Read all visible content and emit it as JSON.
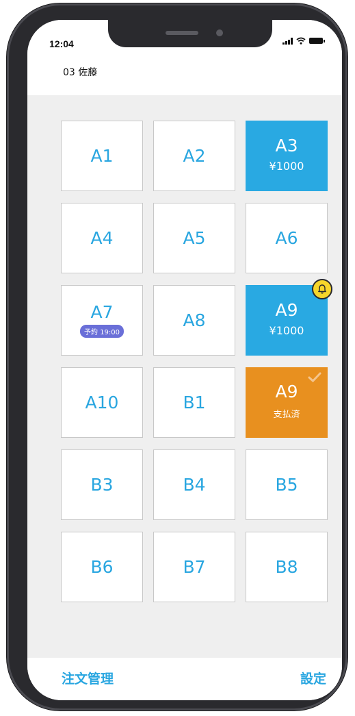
{
  "status_bar": {
    "time": "12:04"
  },
  "header": {
    "user": "03 佐藤"
  },
  "tables": [
    {
      "label": "A1",
      "state": "empty"
    },
    {
      "label": "A2",
      "state": "empty"
    },
    {
      "label": "A3",
      "state": "occupied",
      "amount": "¥1000"
    },
    {
      "label": "A4",
      "state": "empty"
    },
    {
      "label": "A5",
      "state": "empty"
    },
    {
      "label": "A6",
      "state": "empty"
    },
    {
      "label": "A7",
      "state": "reserved",
      "reservation": "予約 19:00"
    },
    {
      "label": "A8",
      "state": "empty"
    },
    {
      "label": "A9",
      "state": "occupied",
      "amount": "¥1000",
      "bell": true
    },
    {
      "label": "A10",
      "state": "empty"
    },
    {
      "label": "B1",
      "state": "empty"
    },
    {
      "label": "A9",
      "state": "paid",
      "paid_label": "支払済"
    },
    {
      "label": "B3",
      "state": "empty"
    },
    {
      "label": "B4",
      "state": "empty"
    },
    {
      "label": "B5",
      "state": "empty"
    },
    {
      "label": "B6",
      "state": "empty"
    },
    {
      "label": "B7",
      "state": "empty"
    },
    {
      "label": "B8",
      "state": "empty"
    }
  ],
  "bottom_nav": {
    "left": "注文管理",
    "right": "設定"
  },
  "colors": {
    "accent_blue": "#29a9e2",
    "paid_orange": "#e8901f",
    "reserve_purple": "#6a6fd8",
    "bell_yellow": "#f7d62a"
  }
}
